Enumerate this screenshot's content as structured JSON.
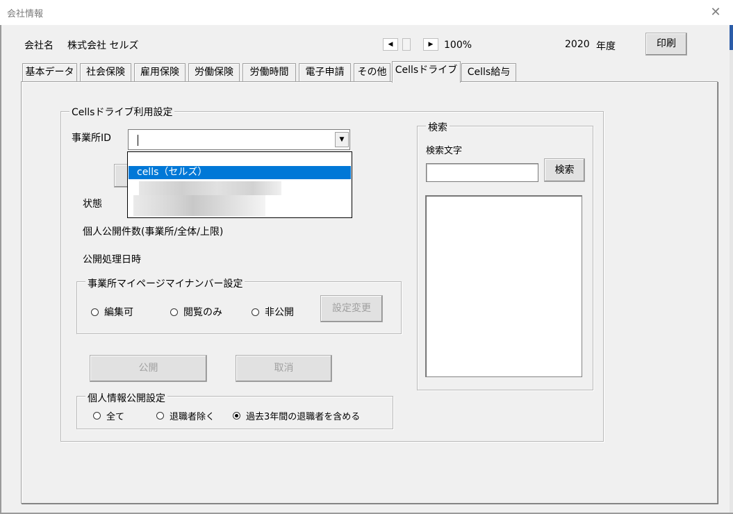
{
  "window": {
    "title": "会社情報",
    "close_icon": "close-icon"
  },
  "header": {
    "company_label": "会社名",
    "company_name": "株式会社 セルズ",
    "zoom": "100%",
    "year": "2020",
    "year_unit": "年度",
    "print_label": "印刷",
    "scroll_left_glyph": "◀",
    "scroll_right_glyph": "▶"
  },
  "tabs": [
    {
      "label": "基本データ"
    },
    {
      "label": "社会保険"
    },
    {
      "label": "雇用保険"
    },
    {
      "label": "労働保険"
    },
    {
      "label": "労働時間"
    },
    {
      "label": "電子申請"
    },
    {
      "label": "その他"
    },
    {
      "label": "Cellsドライブ",
      "active": true
    },
    {
      "label": "Cells給与"
    }
  ],
  "drive": {
    "group_title": "Cellsドライブ利用設定",
    "office_id_label": "事業所ID",
    "office_id_value": "",
    "dropdown_options": [
      "cells（セルズ）"
    ],
    "status_label": "状態",
    "count_label": "個人公開件数(事業所/全体/上限)",
    "datetime_label": "公開処理日時",
    "mypage": {
      "title": "事業所マイページマイナンバー設定",
      "options": [
        "編集可",
        "閲覧のみ",
        "非公開"
      ],
      "change_button": "設定変更"
    },
    "publish_button": "公開",
    "cancel_button": "取消",
    "privacy": {
      "title": "個人情報公開設定",
      "options": [
        "全て",
        "退職者除く",
        "過去3年間の退職者を含める"
      ],
      "selected_index": 2
    }
  },
  "search": {
    "group_title": "検索",
    "text_label": "検索文字",
    "input_value": "",
    "button_label": "検索"
  },
  "colors": {
    "selection": "#0078d7",
    "background": "#f0f0f0"
  }
}
